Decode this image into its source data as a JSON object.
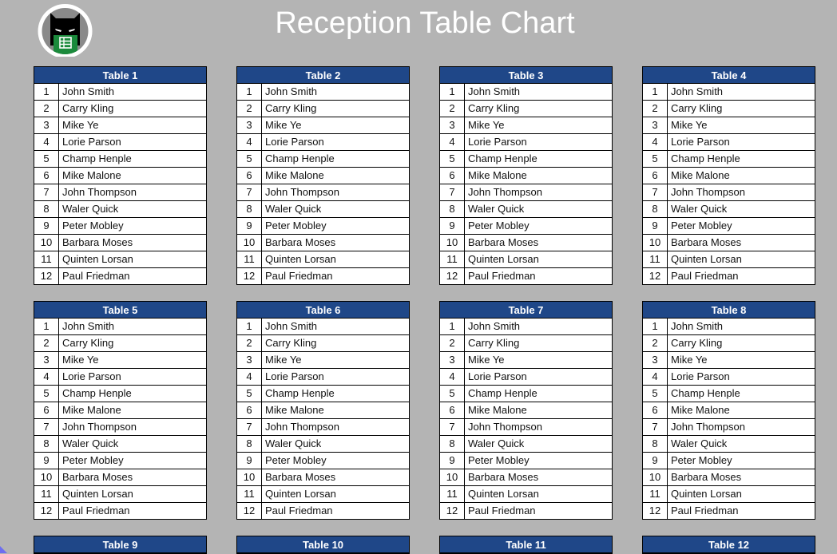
{
  "page": {
    "title": "Reception Table Chart",
    "logo_icon": "cat-mask-spreadsheet-logo"
  },
  "colors": {
    "background": "#b4b4b4",
    "header_fill": "#1f4788",
    "title_text": "#ffffff"
  },
  "guests": [
    "John Smith",
    "Carry Kling",
    "Mike Ye",
    "Lorie Parson",
    "Champ Henple",
    "Mike Malone",
    "John Thompson",
    "Waler Quick",
    "Peter Mobley",
    "Barbara Moses",
    "Quinten Lorsan",
    "Paul Friedman"
  ],
  "tables": [
    {
      "label": "Table 1",
      "seats": [
        "1",
        "2",
        "3",
        "4",
        "5",
        "6",
        "7",
        "8",
        "9",
        "10",
        "11",
        "12"
      ]
    },
    {
      "label": "Table 2",
      "seats": [
        "1",
        "2",
        "3",
        "4",
        "5",
        "6",
        "7",
        "8",
        "9",
        "10",
        "11",
        "12"
      ]
    },
    {
      "label": "Table 3",
      "seats": [
        "1",
        "2",
        "3",
        "4",
        "5",
        "6",
        "7",
        "8",
        "9",
        "10",
        "11",
        "12"
      ]
    },
    {
      "label": "Table 4",
      "seats": [
        "1",
        "2",
        "3",
        "4",
        "5",
        "6",
        "7",
        "8",
        "9",
        "10",
        "11",
        "12"
      ]
    },
    {
      "label": "Table 5",
      "seats": [
        "1",
        "2",
        "3",
        "4",
        "5",
        "6",
        "7",
        "8",
        "9",
        "10",
        "11",
        "12"
      ]
    },
    {
      "label": "Table 6",
      "seats": [
        "1",
        "2",
        "3",
        "4",
        "5",
        "6",
        "7",
        "8",
        "9",
        "10",
        "11",
        "12"
      ]
    },
    {
      "label": "Table 7",
      "seats": [
        "1",
        "2",
        "3",
        "4",
        "5",
        "6",
        "7",
        "8",
        "9",
        "10",
        "11",
        "12"
      ]
    },
    {
      "label": "Table 8",
      "seats": [
        "1",
        "2",
        "3",
        "4",
        "5",
        "6",
        "7",
        "8",
        "9",
        "10",
        "11",
        "12"
      ]
    },
    {
      "label": "Table 9",
      "seats": []
    },
    {
      "label": "Table 10",
      "seats": []
    },
    {
      "label": "Table 11",
      "seats": []
    },
    {
      "label": "Table 12",
      "seats": []
    }
  ]
}
